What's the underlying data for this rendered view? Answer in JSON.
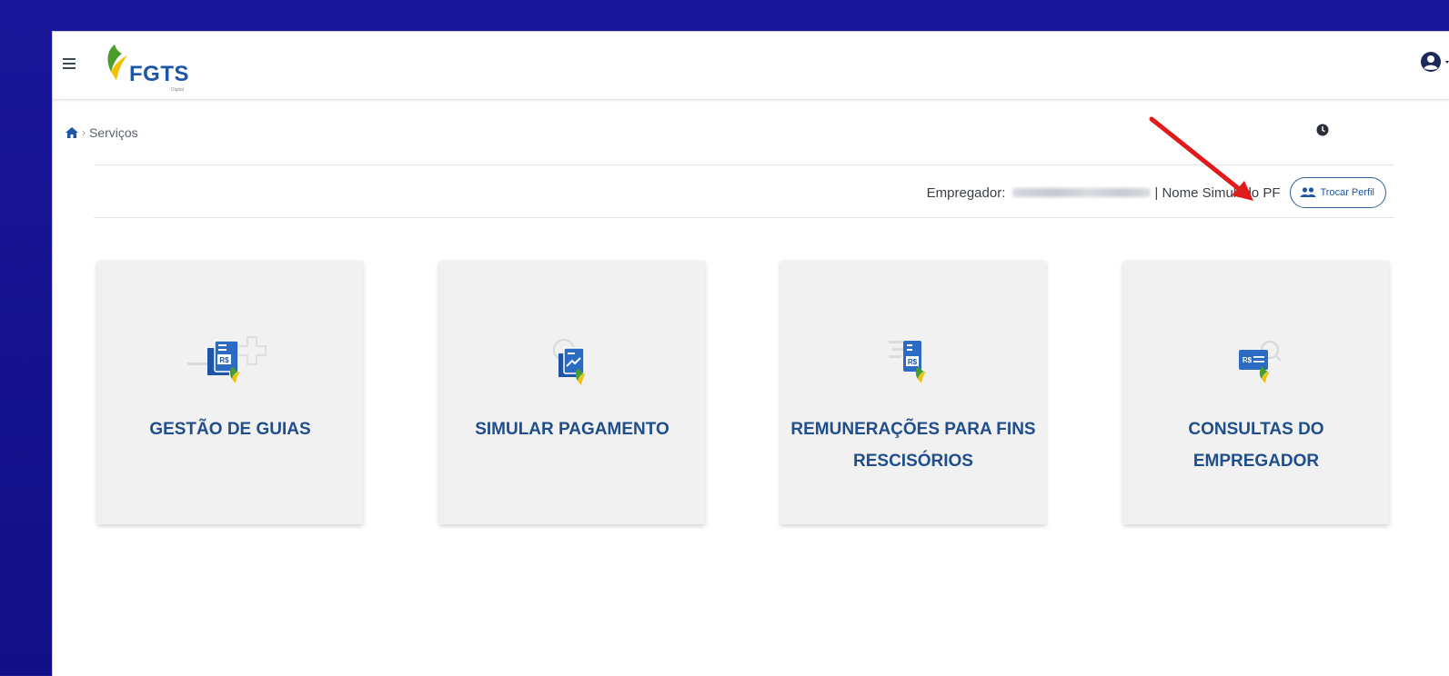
{
  "header": {
    "logo_text": "FGTS",
    "logo_subtext": "Digital"
  },
  "breadcrumb": {
    "current": "Serviços"
  },
  "profile_bar": {
    "employer_label": "Empregador:",
    "name_text": "| Nome Simulado PF",
    "swap_button_label": "Trocar Perfil"
  },
  "cards": [
    {
      "title": "GESTÃO DE GUIAS",
      "icon": "guide-management-icon"
    },
    {
      "title": "SIMULAR PAGAMENTO",
      "icon": "simulate-payment-icon"
    },
    {
      "title": "REMUNERAÇÕES PARA FINS RESCISÓRIOS",
      "icon": "remuneration-icon"
    },
    {
      "title": "CONSULTAS DO EMPREGADOR",
      "icon": "employer-queries-icon"
    }
  ],
  "colors": {
    "background": "#15128a",
    "brand_blue": "#1d56a6",
    "brand_green": "#4a9c2d",
    "brand_yellow": "#f2c200",
    "annotation_arrow": "#e01b1b"
  }
}
